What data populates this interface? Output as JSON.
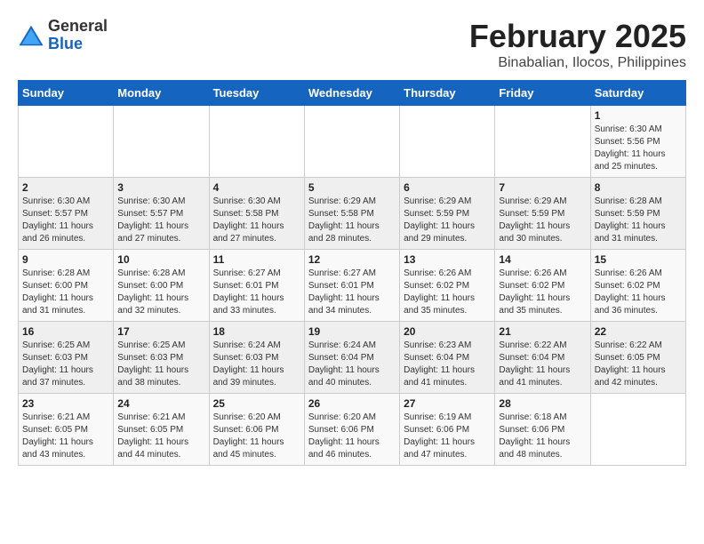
{
  "logo": {
    "general": "General",
    "blue": "Blue"
  },
  "title": "February 2025",
  "subtitle": "Binabalian, Ilocos, Philippines",
  "days_of_week": [
    "Sunday",
    "Monday",
    "Tuesday",
    "Wednesday",
    "Thursday",
    "Friday",
    "Saturday"
  ],
  "weeks": [
    [
      {
        "day": "",
        "detail": ""
      },
      {
        "day": "",
        "detail": ""
      },
      {
        "day": "",
        "detail": ""
      },
      {
        "day": "",
        "detail": ""
      },
      {
        "day": "",
        "detail": ""
      },
      {
        "day": "",
        "detail": ""
      },
      {
        "day": "1",
        "detail": "Sunrise: 6:30 AM\nSunset: 5:56 PM\nDaylight: 11 hours\nand 25 minutes."
      }
    ],
    [
      {
        "day": "2",
        "detail": "Sunrise: 6:30 AM\nSunset: 5:57 PM\nDaylight: 11 hours\nand 26 minutes."
      },
      {
        "day": "3",
        "detail": "Sunrise: 6:30 AM\nSunset: 5:57 PM\nDaylight: 11 hours\nand 27 minutes."
      },
      {
        "day": "4",
        "detail": "Sunrise: 6:30 AM\nSunset: 5:58 PM\nDaylight: 11 hours\nand 27 minutes."
      },
      {
        "day": "5",
        "detail": "Sunrise: 6:29 AM\nSunset: 5:58 PM\nDaylight: 11 hours\nand 28 minutes."
      },
      {
        "day": "6",
        "detail": "Sunrise: 6:29 AM\nSunset: 5:59 PM\nDaylight: 11 hours\nand 29 minutes."
      },
      {
        "day": "7",
        "detail": "Sunrise: 6:29 AM\nSunset: 5:59 PM\nDaylight: 11 hours\nand 30 minutes."
      },
      {
        "day": "8",
        "detail": "Sunrise: 6:28 AM\nSunset: 5:59 PM\nDaylight: 11 hours\nand 31 minutes."
      }
    ],
    [
      {
        "day": "9",
        "detail": "Sunrise: 6:28 AM\nSunset: 6:00 PM\nDaylight: 11 hours\nand 31 minutes."
      },
      {
        "day": "10",
        "detail": "Sunrise: 6:28 AM\nSunset: 6:00 PM\nDaylight: 11 hours\nand 32 minutes."
      },
      {
        "day": "11",
        "detail": "Sunrise: 6:27 AM\nSunset: 6:01 PM\nDaylight: 11 hours\nand 33 minutes."
      },
      {
        "day": "12",
        "detail": "Sunrise: 6:27 AM\nSunset: 6:01 PM\nDaylight: 11 hours\nand 34 minutes."
      },
      {
        "day": "13",
        "detail": "Sunrise: 6:26 AM\nSunset: 6:02 PM\nDaylight: 11 hours\nand 35 minutes."
      },
      {
        "day": "14",
        "detail": "Sunrise: 6:26 AM\nSunset: 6:02 PM\nDaylight: 11 hours\nand 35 minutes."
      },
      {
        "day": "15",
        "detail": "Sunrise: 6:26 AM\nSunset: 6:02 PM\nDaylight: 11 hours\nand 36 minutes."
      }
    ],
    [
      {
        "day": "16",
        "detail": "Sunrise: 6:25 AM\nSunset: 6:03 PM\nDaylight: 11 hours\nand 37 minutes."
      },
      {
        "day": "17",
        "detail": "Sunrise: 6:25 AM\nSunset: 6:03 PM\nDaylight: 11 hours\nand 38 minutes."
      },
      {
        "day": "18",
        "detail": "Sunrise: 6:24 AM\nSunset: 6:03 PM\nDaylight: 11 hours\nand 39 minutes."
      },
      {
        "day": "19",
        "detail": "Sunrise: 6:24 AM\nSunset: 6:04 PM\nDaylight: 11 hours\nand 40 minutes."
      },
      {
        "day": "20",
        "detail": "Sunrise: 6:23 AM\nSunset: 6:04 PM\nDaylight: 11 hours\nand 41 minutes."
      },
      {
        "day": "21",
        "detail": "Sunrise: 6:22 AM\nSunset: 6:04 PM\nDaylight: 11 hours\nand 41 minutes."
      },
      {
        "day": "22",
        "detail": "Sunrise: 6:22 AM\nSunset: 6:05 PM\nDaylight: 11 hours\nand 42 minutes."
      }
    ],
    [
      {
        "day": "23",
        "detail": "Sunrise: 6:21 AM\nSunset: 6:05 PM\nDaylight: 11 hours\nand 43 minutes."
      },
      {
        "day": "24",
        "detail": "Sunrise: 6:21 AM\nSunset: 6:05 PM\nDaylight: 11 hours\nand 44 minutes."
      },
      {
        "day": "25",
        "detail": "Sunrise: 6:20 AM\nSunset: 6:06 PM\nDaylight: 11 hours\nand 45 minutes."
      },
      {
        "day": "26",
        "detail": "Sunrise: 6:20 AM\nSunset: 6:06 PM\nDaylight: 11 hours\nand 46 minutes."
      },
      {
        "day": "27",
        "detail": "Sunrise: 6:19 AM\nSunset: 6:06 PM\nDaylight: 11 hours\nand 47 minutes."
      },
      {
        "day": "28",
        "detail": "Sunrise: 6:18 AM\nSunset: 6:06 PM\nDaylight: 11 hours\nand 48 minutes."
      },
      {
        "day": "",
        "detail": ""
      }
    ]
  ]
}
